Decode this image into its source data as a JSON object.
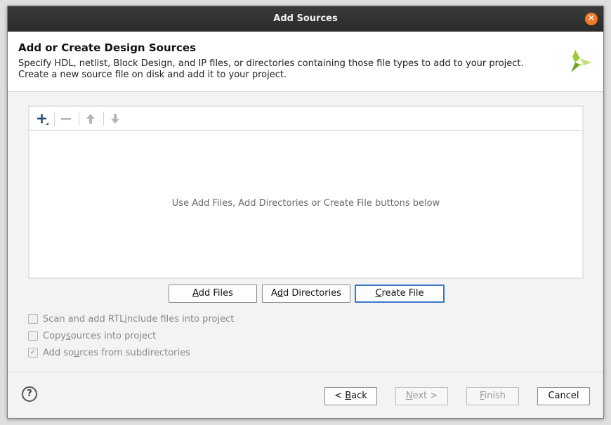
{
  "window": {
    "title": "Add Sources",
    "close_glyph": "✕"
  },
  "header": {
    "title": "Add or Create Design Sources",
    "description": "Specify HDL, netlist, Block Design, and IP files, or directories containing those file types to add to your project. Create a new source file on disk and add it to your project.",
    "logo_icon": "vivado-logo-icon"
  },
  "toolbar": {
    "buttons": [
      {
        "name": "add-icon",
        "glyph": "+"
      },
      {
        "name": "remove-icon",
        "glyph": "−"
      },
      {
        "name": "move-up-icon",
        "glyph": "↑"
      },
      {
        "name": "move-down-icon",
        "glyph": "↓"
      }
    ]
  },
  "file_list": {
    "empty_message": "Use Add Files, Add Directories or Create File buttons below"
  },
  "actions": {
    "add_files": {
      "pre": "",
      "key": "A",
      "post": "dd Files"
    },
    "add_directories": {
      "pre": "A",
      "key": "d",
      "post": "d Directories"
    },
    "create_file": {
      "pre": "",
      "key": "C",
      "post": "reate File"
    }
  },
  "options": [
    {
      "pre": "Scan and add RTL ",
      "key": "i",
      "post": "nclude files into project",
      "checked": false
    },
    {
      "pre": "Copy ",
      "key": "s",
      "post": "ources into project",
      "checked": false
    },
    {
      "pre": "Add so",
      "key": "u",
      "post": "rces from subdirectories",
      "checked": true
    }
  ],
  "footer": {
    "help_glyph": "?",
    "back": {
      "pre": "< ",
      "key": "B",
      "post": "ack"
    },
    "next": {
      "pre": "",
      "key": "N",
      "post": "ext >"
    },
    "finish": {
      "pre": "",
      "key": "F",
      "post": "inish"
    },
    "cancel": "Cancel"
  },
  "colors": {
    "accent": "#3b78c8",
    "close": "#f07a2a",
    "logo_green": "#8dbf2e"
  }
}
